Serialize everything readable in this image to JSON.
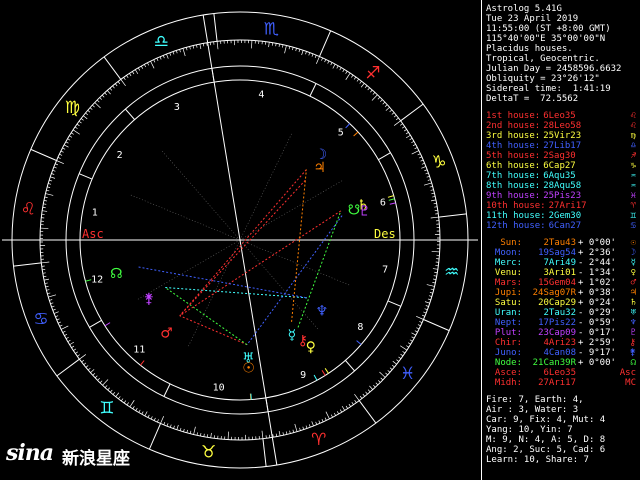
{
  "header": {
    "lines": [
      "Astrolog 5.41G",
      "Tue 23 April 2019",
      "11:55:00 (ST +8:00 GMT)",
      "115°40'00\"E 35°00'00\"N",
      "Placidus houses.",
      "Tropical, Geocentric.",
      "Julian Day = 2458596.6632",
      "Obliquity = 23°26'12\"",
      "Sidereal time:  1:41:19",
      "DeltaT =  72.5562"
    ]
  },
  "houses": [
    {
      "label": "1st house:",
      "value": "6Leo35",
      "color": "#ff3030",
      "sym": "♌"
    },
    {
      "label": "2nd house:",
      "value": "28Leo58",
      "color": "#ff3030",
      "sym": "♌"
    },
    {
      "label": "3rd house:",
      "value": "25Vir23",
      "color": "#ffff40",
      "sym": "♍"
    },
    {
      "label": "4th house:",
      "value": "27Lib17",
      "color": "#4060ff",
      "sym": "♎"
    },
    {
      "label": "5th house:",
      "value": "2Sag30",
      "color": "#ff3030",
      "sym": "♐"
    },
    {
      "label": "6th house:",
      "value": "6Cap27",
      "color": "#ffff40",
      "sym": "♑"
    },
    {
      "label": "7th house:",
      "value": "6Aqu35",
      "color": "#40ffff",
      "sym": "♒"
    },
    {
      "label": "8th house:",
      "value": "28Aqu58",
      "color": "#40ffff",
      "sym": "♒"
    },
    {
      "label": "9th house:",
      "value": "25Pis23",
      "color": "#c040ff",
      "sym": "♓"
    },
    {
      "label": "10th house:",
      "value": "27Ari17",
      "color": "#ff3030",
      "sym": "♈"
    },
    {
      "label": "11th house:",
      "value": "2Gem30",
      "color": "#40ffff",
      "sym": "♊"
    },
    {
      "label": "12th house:",
      "value": "6Can27",
      "color": "#4060ff",
      "sym": "♋"
    }
  ],
  "planets": [
    {
      "label": "Sun:",
      "value": "2Tau43",
      "rate": "+ 0°00'",
      "color": "#ff8000",
      "sym": "☉"
    },
    {
      "label": "Moon:",
      "value": "19Sag54",
      "rate": "+ 2°36'",
      "color": "#4060ff",
      "sym": "☽"
    },
    {
      "label": "Merc:",
      "value": "7Ari49",
      "rate": "- 2°44'",
      "color": "#40ffff",
      "sym": "☿"
    },
    {
      "label": "Venu:",
      "value": "3Ari01",
      "rate": "- 1°34'",
      "color": "#ffff40",
      "sym": "♀"
    },
    {
      "label": "Mars:",
      "value": "15Gem04",
      "rate": "+ 1°02'",
      "color": "#ff3030",
      "sym": "♂"
    },
    {
      "label": "Jupi:",
      "value": "24Sag07R",
      "rate": "+ 0°38'",
      "color": "#ff8000",
      "sym": "♃"
    },
    {
      "label": "Satu:",
      "value": "20Cap29",
      "rate": "+ 0°24'",
      "color": "#ffff40",
      "sym": "♄"
    },
    {
      "label": "Uran:",
      "value": "2Tau32",
      "rate": "- 0°29'",
      "color": "#40ffff",
      "sym": "♅"
    },
    {
      "label": "Nept:",
      "value": "17Pis22",
      "rate": "- 0°59'",
      "color": "#4060ff",
      "sym": "♆"
    },
    {
      "label": "Plut:",
      "value": "23Cap09",
      "rate": "- 0°17'",
      "color": "#c040ff",
      "sym": "♇"
    },
    {
      "label": "Chir:",
      "value": "4Ari23",
      "rate": "+ 2°59'",
      "color": "#ff3030",
      "sym": "⚷"
    },
    {
      "label": "Juno:",
      "value": "4Can08",
      "rate": "- 9°17'",
      "color": "#4060ff",
      "sym": "⚵"
    },
    {
      "label": "Node:",
      "value": "21Can39R",
      "rate": "+ 0°00'",
      "color": "#40ff40",
      "sym": "☊"
    },
    {
      "label": "Asce:",
      "value": "6Leo35",
      "rate": "",
      "color": "#ff3030",
      "sym": "Asc"
    },
    {
      "label": "Midh:",
      "value": "27Ari17",
      "rate": "",
      "color": "#ff3030",
      "sym": "MC"
    }
  ],
  "summary": [
    "Fire: 7, Earth: 4,",
    "Air : 3, Water: 3",
    "Car: 9, Fix: 4, Mut: 4",
    "Yang: 10, Yin: 7",
    "M: 9, N: 4, A: 5, D: 8",
    "Ang: 2, Suc: 5, Cad: 6",
    "Learn: 10, Share: 7"
  ],
  "wheel": {
    "asc_label": "Asc",
    "des_label": "Des",
    "house_numbers": [
      "1",
      "2",
      "3",
      "4",
      "5",
      "6",
      "7",
      "8",
      "9",
      "10",
      "11",
      "12"
    ],
    "signs": [
      {
        "sym": "♈",
        "color": "#ff3030"
      },
      {
        "sym": "♉",
        "color": "#ffff40"
      },
      {
        "sym": "♊",
        "color": "#40ffff"
      },
      {
        "sym": "♋",
        "color": "#4060ff"
      },
      {
        "sym": "♌",
        "color": "#ff3030"
      },
      {
        "sym": "♍",
        "color": "#ffff40"
      },
      {
        "sym": "♎",
        "color": "#40ffff"
      },
      {
        "sym": "♏",
        "color": "#4060ff"
      },
      {
        "sym": "♐",
        "color": "#ff3030"
      },
      {
        "sym": "♑",
        "color": "#ffff40"
      },
      {
        "sym": "♒",
        "color": "#40ffff"
      },
      {
        "sym": "♓",
        "color": "#4060ff"
      }
    ],
    "chart_planets": [
      {
        "sym": "☉",
        "lon": 32.72,
        "color": "#ff8000"
      },
      {
        "sym": "☽",
        "lon": 259.9,
        "color": "#4060ff"
      },
      {
        "sym": "☿",
        "lon": 7.82,
        "color": "#40ffff"
      },
      {
        "sym": "♀",
        "lon": 3.02,
        "color": "#ffff40"
      },
      {
        "sym": "♂",
        "lon": 75.07,
        "color": "#ff3030"
      },
      {
        "sym": "♃",
        "lon": 264.12,
        "color": "#ff8000"
      },
      {
        "sym": "♄",
        "lon": 290.48,
        "color": "#ffff40"
      },
      {
        "sym": "♅",
        "lon": 32.53,
        "color": "#40ffff"
      },
      {
        "sym": "♆",
        "lon": 347.37,
        "color": "#4060ff"
      },
      {
        "sym": "♇",
        "lon": 293.15,
        "color": "#c040ff"
      },
      {
        "sym": "⚷",
        "lon": 4.38,
        "color": "#ff3030"
      },
      {
        "sym": "⚵",
        "lon": 94.13,
        "color": "#c040ff"
      },
      {
        "sym": "☊",
        "lon": 111.65,
        "color": "#40ff40"
      },
      {
        "sym": "☋",
        "lon": 291.65,
        "color": "#40ff40"
      }
    ],
    "asc_lon": 126.58,
    "cusps": [
      126.58,
      148.97,
      175.38,
      207.28,
      242.5,
      276.45,
      306.58,
      328.97,
      355.38,
      27.28,
      62.5,
      96.45
    ],
    "aspects": [
      {
        "a": "☉",
        "b": "♂",
        "color": "#ff3030"
      },
      {
        "a": "☽",
        "b": "♂",
        "color": "#ff3030"
      },
      {
        "a": "☉",
        "b": "⚵",
        "color": "#40ff40"
      },
      {
        "a": "♃",
        "b": "♂",
        "color": "#ff3030"
      },
      {
        "a": "♄",
        "b": "♂",
        "color": "#ff3030"
      },
      {
        "a": "♇",
        "b": "☉",
        "color": "#4060ff"
      },
      {
        "a": "⚵",
        "b": "♆",
        "color": "#40ffff"
      },
      {
        "a": "♀",
        "b": "♄",
        "color": "#40ff40"
      },
      {
        "a": "☊",
        "b": "♆",
        "color": "#4060ff"
      },
      {
        "a": "⚷",
        "b": "☽",
        "color": "#ff8000"
      }
    ]
  },
  "watermark": {
    "logo": "sina",
    "text": "新浪星座"
  }
}
